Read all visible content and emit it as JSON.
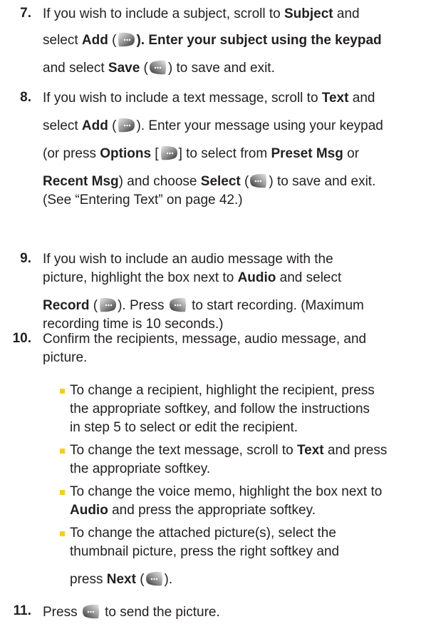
{
  "colors": {
    "text": "#231f20",
    "bullet": "#f6d000",
    "softkey_left_dark": "#3a3a3a",
    "softkey_right_dark": "#3a3a3a"
  },
  "icons": {
    "right_softkey": "right-softkey-icon",
    "left_softkey": "left-softkey-icon"
  },
  "step7": {
    "num": "7.",
    "l1_a": "If you wish to include a subject, scroll to ",
    "l1_b": "Subject",
    "l1_c": " and",
    "l2_a": "select ",
    "l2_b": "Add",
    "l2_c": " (",
    "l2_d": "). Enter your subject using the keypad",
    "l3_a": "and select ",
    "l3_b": "Save",
    "l3_c": " (",
    "l3_d": ") to save and exit."
  },
  "step8": {
    "num": "8.",
    "l1_a": "If you wish to include a text message, scroll to ",
    "l1_b": "Text",
    "l1_c": " and",
    "l2_a": "select ",
    "l2_b": "Add",
    "l2_c": " (",
    "l2_d": "). Enter your message using your keypad",
    "l3_a": "(or press ",
    "l3_b": "Options",
    "l3_c": " [",
    "l3_d": "] to select from ",
    "l3_e": "Preset Msg",
    "l3_f": " or",
    "l4_a": "Recent Msg",
    "l4_b": ") and choose ",
    "l4_c": "Select",
    "l4_d": " (",
    "l4_e": ") to save and exit.",
    "l5": "(See “Entering Text” on page 42.)"
  },
  "step9": {
    "num": "9.",
    "l1": "If you wish to include an audio message with the",
    "l2_a": "picture, highlight the box next to ",
    "l2_b": "Audio",
    "l2_c": " and select",
    "l3_a": "Record",
    "l3_b": " (",
    "l3_c": "). Press ",
    "l3_d": " to start recording. (Maximum",
    "l4": "recording time is 10 seconds.)"
  },
  "step10": {
    "num": "10.",
    "l1": "Confirm the recipients, message, audio message, and",
    "l2": "picture.",
    "b1_l1": "To change a recipient, highlight the recipient, press",
    "b1_l2": "the appropriate softkey, and follow the instructions",
    "b1_l3": "in step 5 to select or edit the recipient.",
    "b2_l1_a": "To change the text message, scroll to ",
    "b2_l1_b": "Text",
    "b2_l1_c": " and press",
    "b2_l2": "the appropriate softkey.",
    "b3_l1": "To change the voice memo, highlight the box next to",
    "b3_l2_a": "Audio",
    "b3_l2_b": " and press the appropriate softkey.",
    "b4_l1": "To change the attached picture(s), select the",
    "b4_l2": "thumbnail picture, press the right softkey and",
    "b4_l3_a": "press ",
    "b4_l3_b": "Next",
    "b4_l3_c": " (",
    "b4_l3_d": ")."
  },
  "step11": {
    "num": "11.",
    "l1_a": "Press ",
    "l1_b": " to send the picture."
  }
}
